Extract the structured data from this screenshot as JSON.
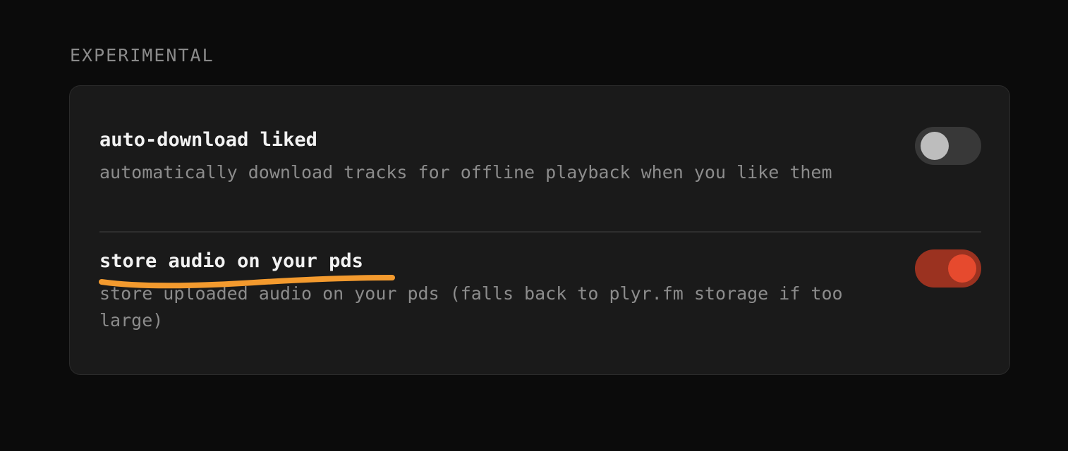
{
  "section": {
    "heading": "EXPERIMENTAL"
  },
  "settings": [
    {
      "title": "auto-download liked",
      "description": "automatically download tracks for offline playback when you like them",
      "enabled": false
    },
    {
      "title": "store audio on your pds",
      "description": "store uploaded audio on your pds (falls back to plyr.fm storage if too large)",
      "enabled": true
    }
  ],
  "colors": {
    "page_background": "#0b0b0b",
    "card_background": "#1a1a1a",
    "toggle_on_track": "#9b3220",
    "toggle_on_knob": "#e64a2e",
    "toggle_off_track": "#383838",
    "toggle_off_knob": "#bdbdbd",
    "annotation": "#f39a2e"
  },
  "annotation": {
    "type": "hand-drawn-underline",
    "target": "settings.1.title"
  }
}
